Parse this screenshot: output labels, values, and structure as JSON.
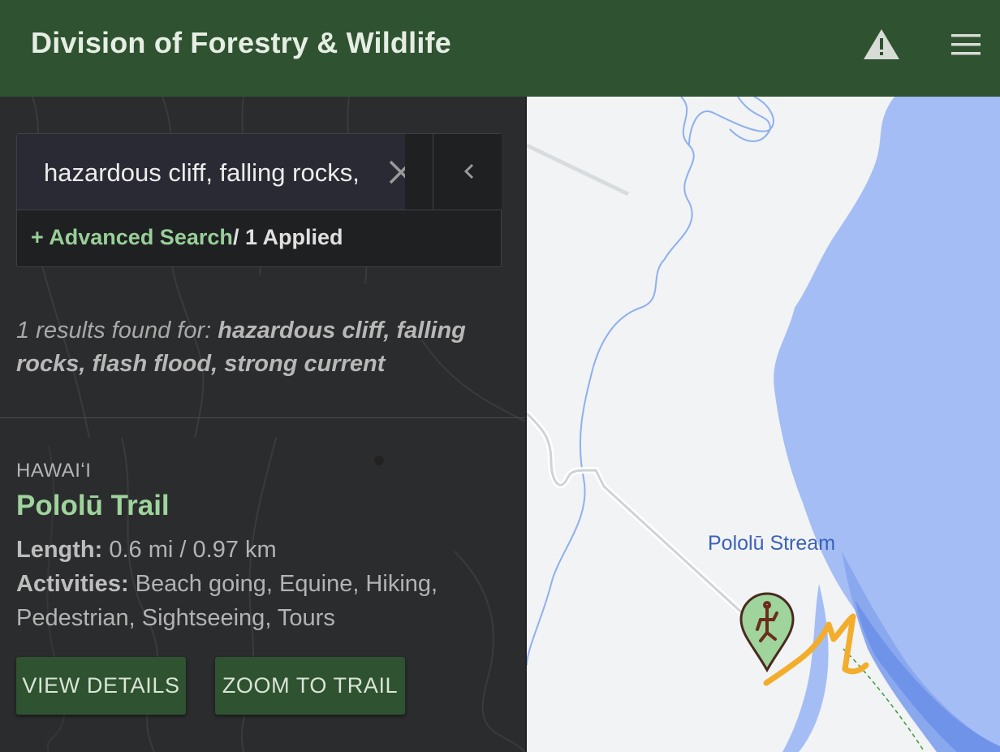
{
  "header": {
    "title": "Division of Forestry & Wildlife",
    "alert_icon": "warning-triangle-icon",
    "menu_icon": "hamburger-menu-icon",
    "bg_color": "#2f5230"
  },
  "search": {
    "value": "hazardous cliff, falling rocks,",
    "clear_icon": "close-icon",
    "collapse_icon": "chevron-left-icon",
    "advanced_label": "+ Advanced Search",
    "applied_label": "/ 1 Applied"
  },
  "results": {
    "prefix": "1 results found for: ",
    "query": "hazardous cliff, falling rocks, flash flood, strong current"
  },
  "trail": {
    "region": "HAWAIʻI",
    "name": "Pololū Trail",
    "length_label": "Length:",
    "length_value": " 0.6 mi / 0.97 km",
    "activities_label": "Activities:",
    "activities_value": " Beach going, Equine, Hiking, Pedestrian, Sightseeing, Tours",
    "view_details_label": "VIEW DETAILS",
    "zoom_label": "ZOOM TO TRAIL"
  },
  "map": {
    "stream_label": "Pololū Stream",
    "marker_icon": "petroglyph-hiker-icon",
    "water_color": "#a4bdf4",
    "trail_color": "#f2ad2c"
  }
}
